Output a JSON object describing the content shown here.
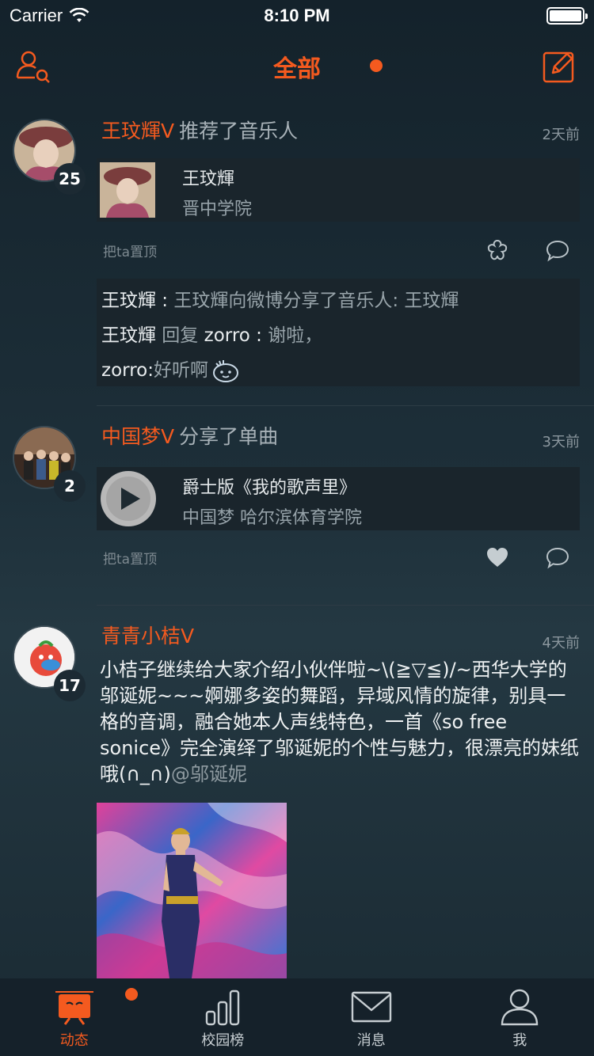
{
  "status_bar": {
    "carrier": "Carrier",
    "time": "8:10 PM"
  },
  "nav": {
    "title": "全部"
  },
  "colors": {
    "accent": "#f45a1f",
    "background": "#1a2a33"
  },
  "posts": [
    {
      "author": "王玟輝V",
      "action": "推荐了音乐人",
      "time": "2天前",
      "badge": "25",
      "card": {
        "title": "王玟輝",
        "subtitle": "晋中学院"
      },
      "pin_label": "把ta置顶",
      "comments": [
        {
          "name": "王玟輝",
          "sep": " : ",
          "text": "王玟輝向微博分享了音乐人:  王玟輝"
        },
        {
          "name": "王玟輝",
          "mid": " 回复 ",
          "target": "zorro",
          "sep": " : ",
          "text": "谢啦，"
        },
        {
          "name": "zorro",
          "sep": " : ",
          "text": "好听啊"
        }
      ]
    },
    {
      "author": "中国梦V",
      "action": "分享了单曲",
      "time": "3天前",
      "badge": "2",
      "card": {
        "title": "爵士版《我的歌声里》",
        "subtitle": "中国梦 哈尔滨体育学院"
      },
      "pin_label": "把ta置顶"
    },
    {
      "author": "青青小桔V",
      "time": "4天前",
      "badge": "17",
      "body": "小桔子继续给大家介绍小伙伴啦~\\(≧▽≦)/~西华大学的邬诞妮~~~婀娜多姿的舞蹈，异域风情的旋律，别具一格的音调，融合她本人声线特色，一首《so free sonice》完全演绎了邬诞妮的个性与魅力，很漂亮的妹纸哦(∩_∩)",
      "mention": "@邬诞妮"
    }
  ],
  "tabs": [
    {
      "label": "动态",
      "icon": "tv-icon",
      "active": true
    },
    {
      "label": "校园榜",
      "icon": "bar-chart-icon"
    },
    {
      "label": "消息",
      "icon": "mail-icon"
    },
    {
      "label": "我",
      "icon": "person-icon"
    }
  ]
}
